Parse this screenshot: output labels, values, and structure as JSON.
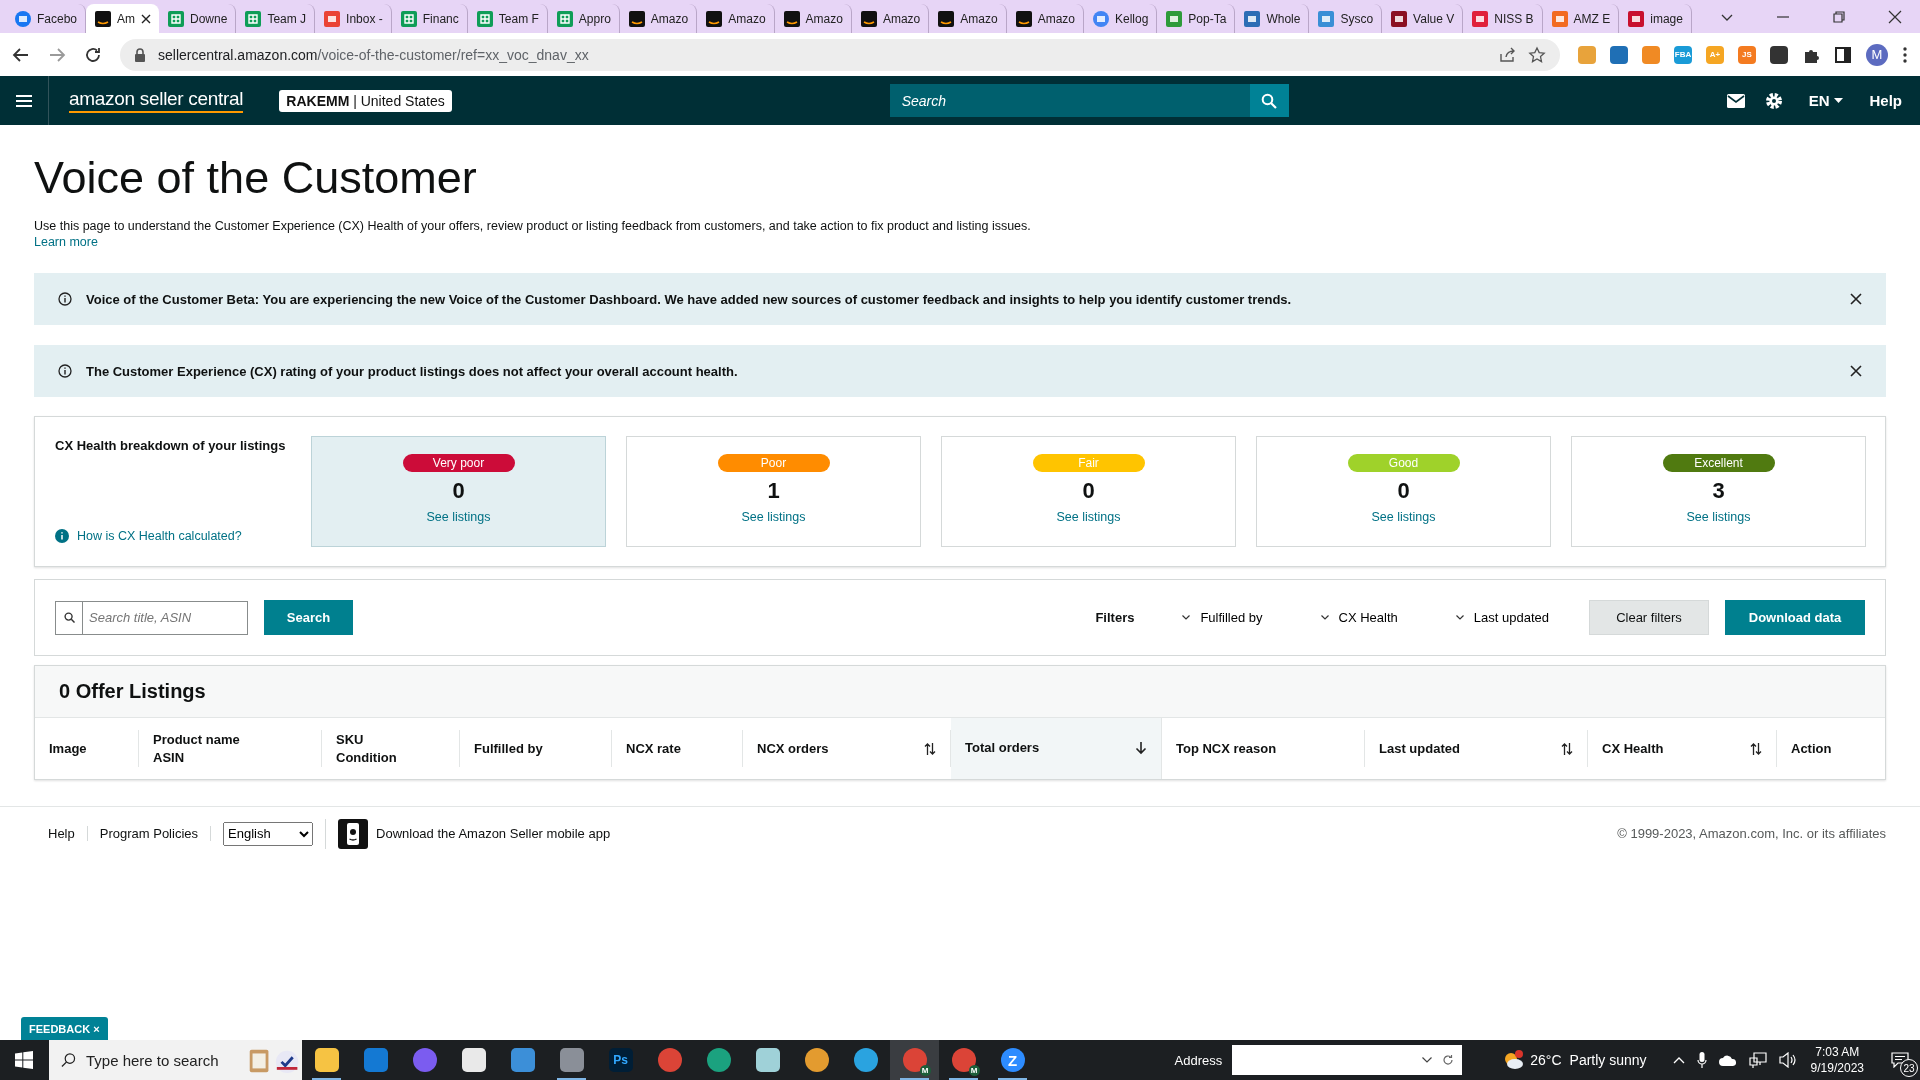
{
  "browser": {
    "tabs": [
      {
        "label": "Facebo",
        "kind": "facebook",
        "selected": false
      },
      {
        "label": "Am",
        "kind": "amazon",
        "selected": true
      },
      {
        "label": "Downe",
        "kind": "sheets",
        "selected": false
      },
      {
        "label": "Team J",
        "kind": "sheets",
        "selected": false
      },
      {
        "label": "Inbox -",
        "kind": "gmail",
        "selected": false
      },
      {
        "label": "Financ",
        "kind": "sheets",
        "selected": false
      },
      {
        "label": "Team F",
        "kind": "sheets",
        "selected": false
      },
      {
        "label": "Appro",
        "kind": "sheets",
        "selected": false
      },
      {
        "label": "Amazo",
        "kind": "amazon",
        "selected": false
      },
      {
        "label": "Amazo",
        "kind": "amazon",
        "selected": false
      },
      {
        "label": "Amazo",
        "kind": "amazon",
        "selected": false
      },
      {
        "label": "Amazo",
        "kind": "amazon",
        "selected": false
      },
      {
        "label": "Amazo",
        "kind": "amazon",
        "selected": false
      },
      {
        "label": "Amazo",
        "kind": "amazon",
        "selected": false
      },
      {
        "label": "Kellog",
        "kind": "google",
        "selected": false
      },
      {
        "label": "Pop-Ta",
        "kind": "popta",
        "selected": false
      },
      {
        "label": "Whole",
        "kind": "whole",
        "selected": false
      },
      {
        "label": "Sysco",
        "kind": "sysco",
        "selected": false
      },
      {
        "label": "Value V",
        "kind": "value",
        "selected": false
      },
      {
        "label": "NISS B",
        "kind": "niss",
        "selected": false
      },
      {
        "label": "AMZ E",
        "kind": "amz",
        "selected": false
      },
      {
        "label": "image",
        "kind": "image",
        "selected": false
      }
    ],
    "forward_enabled": false,
    "url_host": "sellercentral.amazon.com",
    "url_path": "/voice-of-the-customer/ref=xx_voc_dnav_xx",
    "extensions": [
      {
        "kind": "honey"
      },
      {
        "kind": "wheel"
      },
      {
        "kind": "ring"
      },
      {
        "kind": "fba",
        "label": "FBA"
      },
      {
        "kind": "scout",
        "label": "A+"
      },
      {
        "kind": "js",
        "label": "JS"
      },
      {
        "kind": "broom"
      }
    ],
    "profile_initial": "M"
  },
  "header": {
    "logo": "amazon seller central",
    "store": "**RAKEMM** | United States",
    "search_placeholder": "Search",
    "language": "EN",
    "help": "Help"
  },
  "page": {
    "title": "Voice of the Customer",
    "description": "Use this page to understand the Customer Experience (CX) Health of your offers, review product or listing feedback from customers, and take action to fix product and listing issues.",
    "learn_more": "Learn more"
  },
  "banners": [
    {
      "text": "Voice of the Customer Beta: You are experiencing the new Voice of the Customer Dashboard. We have added new sources of customer feedback and insights to help you identify customer trends."
    },
    {
      "text": "The Customer Experience (CX) rating of your product listings does not affect your overall account health."
    }
  ],
  "cx_health": {
    "title": "CX Health breakdown of your listings",
    "help_link": "How is CX Health calculated?",
    "cards": [
      {
        "label": "Very poor",
        "color": "#cc0c39",
        "count": "0",
        "link": "See listings",
        "selected": true
      },
      {
        "label": "Poor",
        "color": "#ff8c00",
        "count": "1",
        "link": "See listings",
        "selected": false
      },
      {
        "label": "Fair",
        "color": "#ffc400",
        "count": "0",
        "link": "See listings",
        "selected": false
      },
      {
        "label": "Good",
        "color": "#9fd22a",
        "count": "0",
        "link": "See listings",
        "selected": false
      },
      {
        "label": "Excellent",
        "color": "#507a10",
        "count": "3",
        "link": "See listings",
        "selected": false
      }
    ]
  },
  "toolbar": {
    "search_placeholder": "Search title, ASIN",
    "search_button": "Search",
    "filters_label": "Filters",
    "filters": [
      "Fulfilled by",
      "CX Health",
      "Last updated"
    ],
    "clear": "Clear filters",
    "download": "Download data"
  },
  "table": {
    "title": "0 Offer Listings",
    "columns": [
      {
        "label": "Image",
        "kind": "plain",
        "selected": false
      },
      {
        "label": "Product name",
        "label2": "ASIN",
        "kind": "plain",
        "selected": false
      },
      {
        "label": "SKU",
        "label2": "Condition",
        "kind": "plain",
        "selected": false
      },
      {
        "label": "Fulfilled by",
        "kind": "plain",
        "selected": false
      },
      {
        "label": "NCX rate",
        "kind": "plain",
        "selected": false
      },
      {
        "label": "NCX orders",
        "kind": "updown",
        "selected": false
      },
      {
        "label": "Total orders",
        "kind": "down",
        "selected": true
      },
      {
        "label": "Top NCX reason",
        "kind": "plain",
        "selected": false
      },
      {
        "label": "Last updated",
        "kind": "updown",
        "selected": false
      },
      {
        "label": "CX Health",
        "kind": "updown",
        "selected": false
      },
      {
        "label": "Action",
        "kind": "plain",
        "selected": false
      }
    ]
  },
  "footer": {
    "links": [
      "Help",
      "Program Policies"
    ],
    "language": "English",
    "app_link": "Download the Amazon Seller mobile app",
    "copyright": "© 1999-2023, Amazon.com, Inc. or its affiliates"
  },
  "feedback": {
    "label": "FEEDBACK",
    "close": "×"
  },
  "taskbar": {
    "search_placeholder": "Type here to search",
    "apps": [
      {
        "kind": "explorer",
        "running": true,
        "selected": false
      },
      {
        "kind": "mail",
        "running": false,
        "selected": false
      },
      {
        "kind": "copilot",
        "running": false,
        "selected": false
      },
      {
        "kind": "store",
        "running": false,
        "selected": false
      },
      {
        "kind": "panel",
        "running": false,
        "selected": false
      },
      {
        "kind": "calculator",
        "running": true,
        "selected": false
      },
      {
        "kind": "photoshop",
        "label": "Ps",
        "running": false,
        "selected": false
      },
      {
        "kind": "chrome",
        "running": false,
        "selected": false
      },
      {
        "kind": "edge",
        "running": false,
        "selected": false
      },
      {
        "kind": "notepad",
        "running": false,
        "selected": false
      },
      {
        "kind": "mascot",
        "running": false,
        "selected": false
      },
      {
        "kind": "telegram",
        "running": false,
        "selected": false
      },
      {
        "kind": "chrome",
        "badge": "M",
        "running": true,
        "selected": true
      },
      {
        "kind": "chrome",
        "badge": "M",
        "running": true,
        "selected": false
      },
      {
        "kind": "zoom",
        "label": "Z",
        "running": true,
        "selected": false
      }
    ],
    "address_label": "Address",
    "temperature": "26°C",
    "weather": "Partly sunny",
    "time": "7:03 AM",
    "date": "9/19/2023",
    "notifications": "23"
  }
}
